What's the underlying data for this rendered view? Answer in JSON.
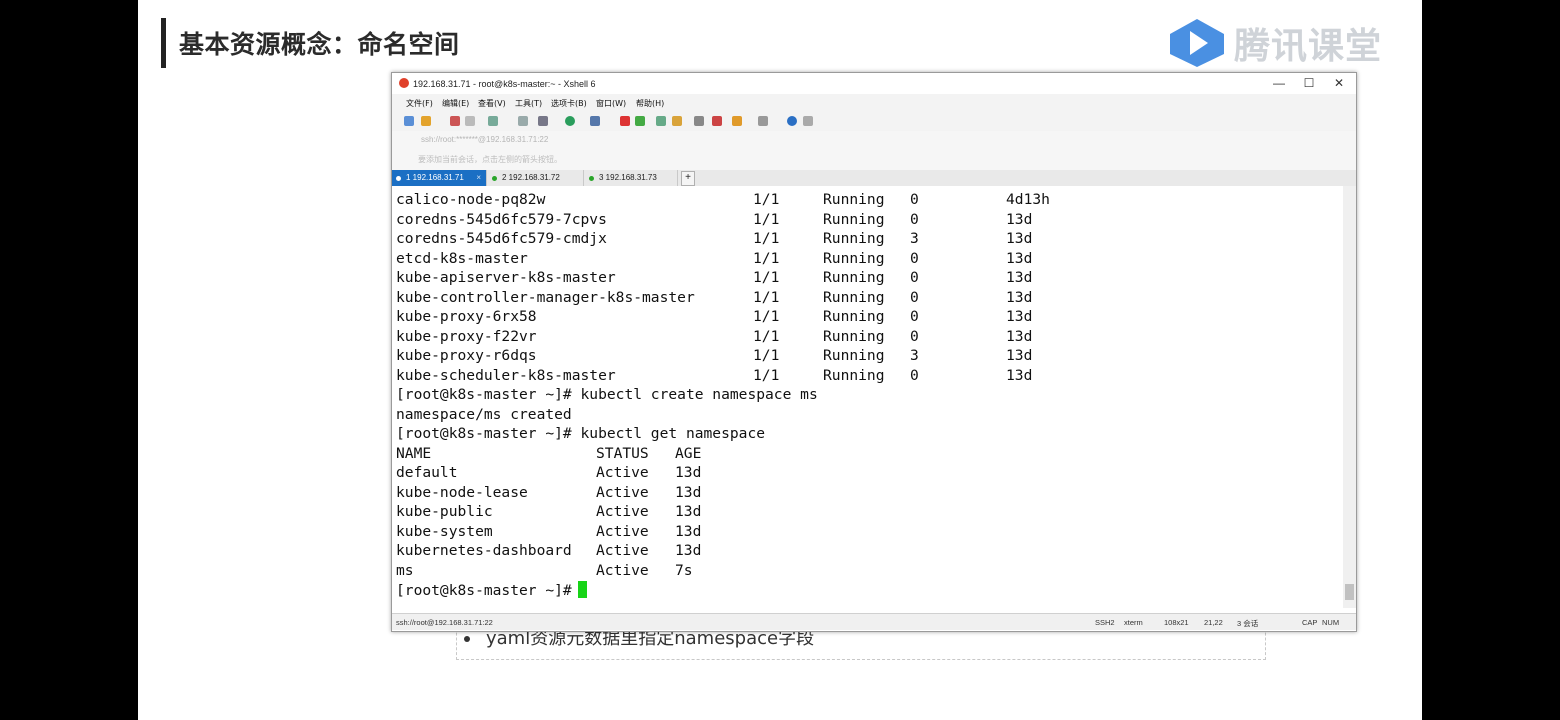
{
  "slide": {
    "title": "基本资源概念：命名空间",
    "logo_text": "腾讯课堂",
    "bullet": "yaml资源元数据里指定namespace字段"
  },
  "window": {
    "title": "192.168.31.71 - root@k8s-master:~ - Xshell 6",
    "min": "—",
    "max": "☐",
    "close": "✕",
    "menus": [
      "文件(F)",
      "编辑(E)",
      "查看(V)",
      "工具(T)",
      "选项卡(B)",
      "窗口(W)",
      "帮助(H)"
    ],
    "address": "ssh://root:*******@192.168.31.71:22",
    "hint": "要添加当前会话，点击左侧的箭头按钮。",
    "tabs": [
      {
        "label": "1 192.168.31.71",
        "close": "×"
      },
      {
        "label": "2 192.168.31.72"
      },
      {
        "label": "3 192.168.31.73"
      }
    ],
    "tab_add": "+"
  },
  "terminal": {
    "pods": [
      {
        "name": "calico-node-pq82w",
        "ready": "1/1",
        "status": "Running",
        "restarts": "0",
        "age": "4d13h"
      },
      {
        "name": "coredns-545d6fc579-7cpvs",
        "ready": "1/1",
        "status": "Running",
        "restarts": "0",
        "age": "13d"
      },
      {
        "name": "coredns-545d6fc579-cmdjx",
        "ready": "1/1",
        "status": "Running",
        "restarts": "3",
        "age": "13d"
      },
      {
        "name": "etcd-k8s-master",
        "ready": "1/1",
        "status": "Running",
        "restarts": "0",
        "age": "13d"
      },
      {
        "name": "kube-apiserver-k8s-master",
        "ready": "1/1",
        "status": "Running",
        "restarts": "0",
        "age": "13d"
      },
      {
        "name": "kube-controller-manager-k8s-master",
        "ready": "1/1",
        "status": "Running",
        "restarts": "0",
        "age": "13d"
      },
      {
        "name": "kube-proxy-6rx58",
        "ready": "1/1",
        "status": "Running",
        "restarts": "0",
        "age": "13d"
      },
      {
        "name": "kube-proxy-f22vr",
        "ready": "1/1",
        "status": "Running",
        "restarts": "0",
        "age": "13d"
      },
      {
        "name": "kube-proxy-r6dqs",
        "ready": "1/1",
        "status": "Running",
        "restarts": "3",
        "age": "13d"
      },
      {
        "name": "kube-scheduler-k8s-master",
        "ready": "1/1",
        "status": "Running",
        "restarts": "0",
        "age": "13d"
      }
    ],
    "cmd1": "[root@k8s-master ~]# kubectl create namespace ms",
    "out1": "namespace/ms created",
    "cmd2": "[root@k8s-master ~]# kubectl get namespace",
    "ns_header": {
      "name": "NAME",
      "status": "STATUS",
      "age": "AGE"
    },
    "namespaces": [
      {
        "name": "default",
        "status": "Active",
        "age": "13d"
      },
      {
        "name": "kube-node-lease",
        "status": "Active",
        "age": "13d"
      },
      {
        "name": "kube-public",
        "status": "Active",
        "age": "13d"
      },
      {
        "name": "kube-system",
        "status": "Active",
        "age": "13d"
      },
      {
        "name": "kubernetes-dashboard",
        "status": "Active",
        "age": "13d"
      },
      {
        "name": "ms",
        "status": "Active",
        "age": "7s"
      }
    ],
    "prompt": "[root@k8s-master ~]#"
  },
  "statusbar": {
    "connection": "ssh://root@192.168.31.71:22",
    "protocol": "SSH2",
    "term": "xterm",
    "size": "108x21",
    "pos": "21,22",
    "sessions": "3 会话",
    "cap": "CAP",
    "num": "NUM"
  },
  "colors": {
    "tab_active": "#1b6fc4",
    "cursor": "#17d417",
    "logo": "#4a90e2"
  }
}
